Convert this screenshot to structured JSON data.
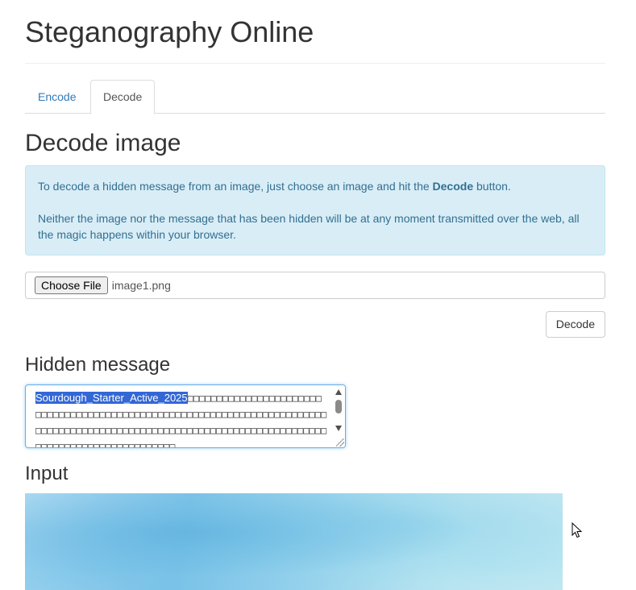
{
  "header": {
    "title": "Steganography Online"
  },
  "tabs": [
    {
      "label": "Encode",
      "active": false
    },
    {
      "label": "Decode",
      "active": true
    }
  ],
  "decode": {
    "heading": "Decode image",
    "info_line1_pre": "To decode a hidden message from an image, just choose an image and hit the ",
    "info_line1_bold": "Decode",
    "info_line1_post": " button.",
    "info_line2": "Neither the image nor the message that has been hidden will be at any moment transmitted over the web, all the magic happens within your browser.",
    "file_button_label": "Choose File",
    "file_name": "image1.png",
    "decode_button_label": "Decode"
  },
  "hidden_message": {
    "heading": "Hidden message",
    "selected_text": "Sourdough_Starter_Active_2025",
    "trailing_text": "□□□□□□□□□□□□□□□□□□□□□□□□□□□□□□□□□□□□□□□□□□□□□□□□□□□□□□□□□□□□□□□□□□□□□□□□□□□□□□□□□□□□□□□□□□□□□□□□□□□□□□□□□□□□□□□□□□□□□□□□□□□□□□□□□□□□□□□□□□□□□□□□□□□"
  },
  "input_section": {
    "heading": "Input"
  },
  "colors": {
    "link": "#337ab7",
    "info_bg": "#d9edf7",
    "info_text": "#31708f",
    "selection": "#3367d6"
  }
}
